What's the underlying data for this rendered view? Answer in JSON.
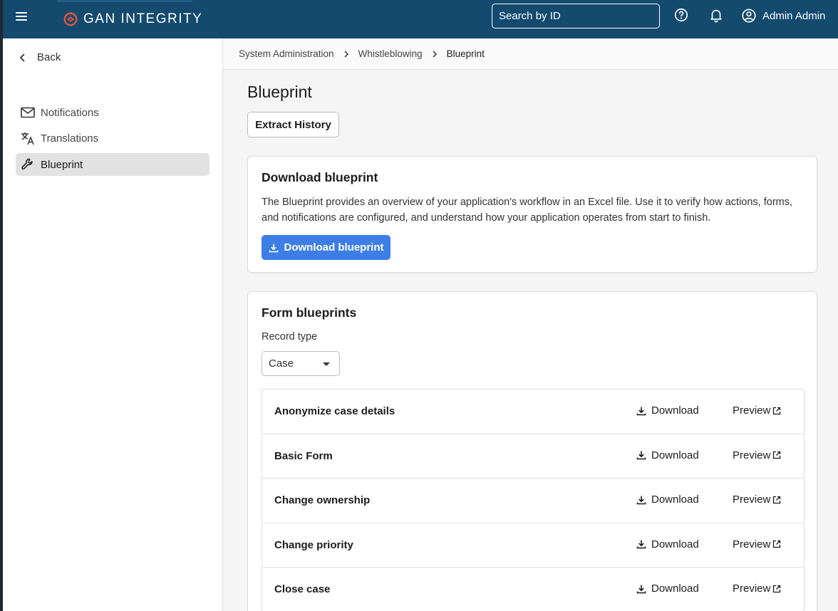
{
  "header": {
    "brand": "GAN INTEGRITY",
    "search_placeholder": "Search by ID",
    "user_name": "Admin Admin",
    "icons": {
      "menu": "hamburger-menu-icon",
      "help": "help-circle-icon",
      "notifications": "bell-icon",
      "user": "user-circle-icon"
    }
  },
  "sidebar": {
    "back_label": "Back",
    "items": [
      {
        "label": "Notifications",
        "icon": "mail-icon"
      },
      {
        "label": "Translations",
        "icon": "translate-icon"
      },
      {
        "label": "Blueprint",
        "icon": "wrench-icon",
        "active": true
      }
    ]
  },
  "breadcrumb": [
    "System Administration",
    "Whistleblowing",
    "Blueprint"
  ],
  "page": {
    "title": "Blueprint",
    "extract_history_label": "Extract History"
  },
  "download_card": {
    "title": "Download blueprint",
    "description": "The Blueprint provides an overview of your application's workflow in an Excel file. Use it to verify how actions, forms, and notifications are configured, and understand how your application operates from start to finish.",
    "button_label": "Download blueprint"
  },
  "forms_card": {
    "title": "Form blueprints",
    "record_type_label": "Record type",
    "record_type_value": "Case",
    "download_label": "Download",
    "preview_label": "Preview",
    "rows": [
      {
        "name": "Anonymize case details"
      },
      {
        "name": "Basic Form"
      },
      {
        "name": "Change ownership"
      },
      {
        "name": "Change priority"
      },
      {
        "name": "Close case"
      }
    ]
  },
  "colors": {
    "topbar": "#134a6e",
    "primary": "#3d7ee6",
    "logo_accent": "#e8543c"
  }
}
